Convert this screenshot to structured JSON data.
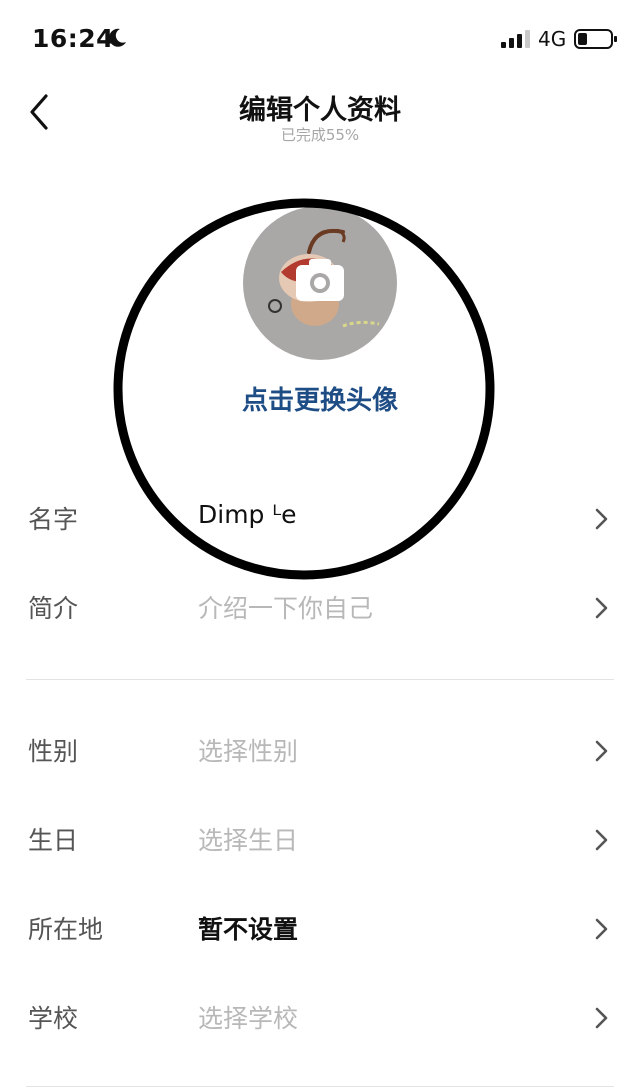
{
  "status_bar": {
    "time": "16:24",
    "network": "4G",
    "icons": [
      "moon-icon",
      "signal-icon",
      "battery-icon"
    ]
  },
  "header": {
    "title": "编辑个人资料",
    "subtitle": "已完成55%",
    "back_icon": "chevron-left-icon"
  },
  "avatar": {
    "change_label": "点击更换头像",
    "overlay_icon": "camera-icon"
  },
  "section_basic": {
    "rows": [
      {
        "label": "名字",
        "value": "Dimp ᴸe",
        "style": "filled"
      },
      {
        "label": "简介",
        "value": "介绍一下你自己",
        "style": "placeholder"
      }
    ]
  },
  "section_details": {
    "rows": [
      {
        "label": "性别",
        "value": "选择性别",
        "style": "placeholder"
      },
      {
        "label": "生日",
        "value": "选择生日",
        "style": "placeholder"
      },
      {
        "label": "所在地",
        "value": "暂不设置",
        "style": "strong"
      },
      {
        "label": "学校",
        "value": "选择学校",
        "style": "placeholder"
      }
    ]
  },
  "colors": {
    "link": "#1e4d85",
    "label": "#555555",
    "placeholder": "#b8b8b8",
    "divider": "#e3e3e3",
    "annotation": "#000000"
  }
}
